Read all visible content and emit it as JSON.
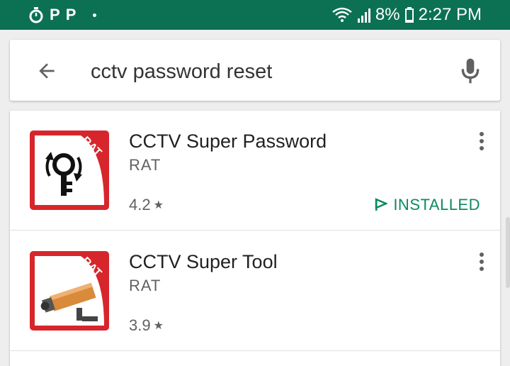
{
  "status_bar": {
    "left_icons": [
      "timer-icon",
      "paypal-icon",
      "paypal-icon",
      "dot-icon"
    ],
    "battery": "8%",
    "time": "2:27 PM",
    "background_color": "#0c7152"
  },
  "search": {
    "query": "cctv password reset",
    "icons": {
      "back": "back-arrow-icon",
      "voice": "microphone-icon"
    }
  },
  "results": [
    {
      "title": "CCTV Super Password",
      "developer": "RAT",
      "rating": "4.2",
      "status": "INSTALLED",
      "icon": "cctv-super-password-app-icon",
      "icon_badge": "RAT"
    },
    {
      "title": "CCTV Super Tool",
      "developer": "RAT",
      "rating": "3.9",
      "icon": "cctv-super-tool-app-icon",
      "icon_badge": "RAT"
    }
  ],
  "colors": {
    "accent_green": "#0b8a62",
    "icon_red": "#d7262b"
  }
}
